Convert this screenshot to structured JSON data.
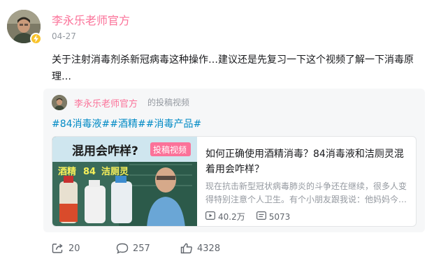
{
  "post": {
    "author": "李永乐老师官方",
    "time": "04-27",
    "text": "关于注射消毒剂杀新冠病毒这种操作…建议还是先复习一下这个视频了解一下消毒原理…"
  },
  "card": {
    "author": "李永乐老师官方",
    "action": "的投稿视频",
    "tags": [
      "#84消毒液#",
      "#酒精#",
      "#消毒产品#"
    ],
    "video": {
      "thumb_title": "混用会咋样?",
      "thumb_badge": "投稿视频",
      "thumb_labels": [
        "酒精",
        "84",
        "洁厕灵"
      ],
      "title": "如何正确使用酒精消毒？84消毒液和洁厕灵混着用会咋样？",
      "desc": "现在抗击新型冠状病毒肺炎的斗争还在继续，很多人变得特别注意个人卫生。有个小朋友跟我说：他妈妈今…",
      "views": "40.2万",
      "danmaku": "5073"
    }
  },
  "actions": {
    "repost": "20",
    "comment": "257",
    "like": "4328"
  },
  "icons": {
    "repost": "repost-icon",
    "comment": "comment-icon",
    "like": "thumbs-up-icon",
    "views": "play-icon",
    "danmaku": "danmaku-icon",
    "verified": "lightning-badge-icon"
  },
  "colors": {
    "author": "#fb7299",
    "tag": "#008ac5",
    "muted": "#9499a0",
    "card_bg": "#f6f7f8",
    "badge": "#f8c32b"
  }
}
